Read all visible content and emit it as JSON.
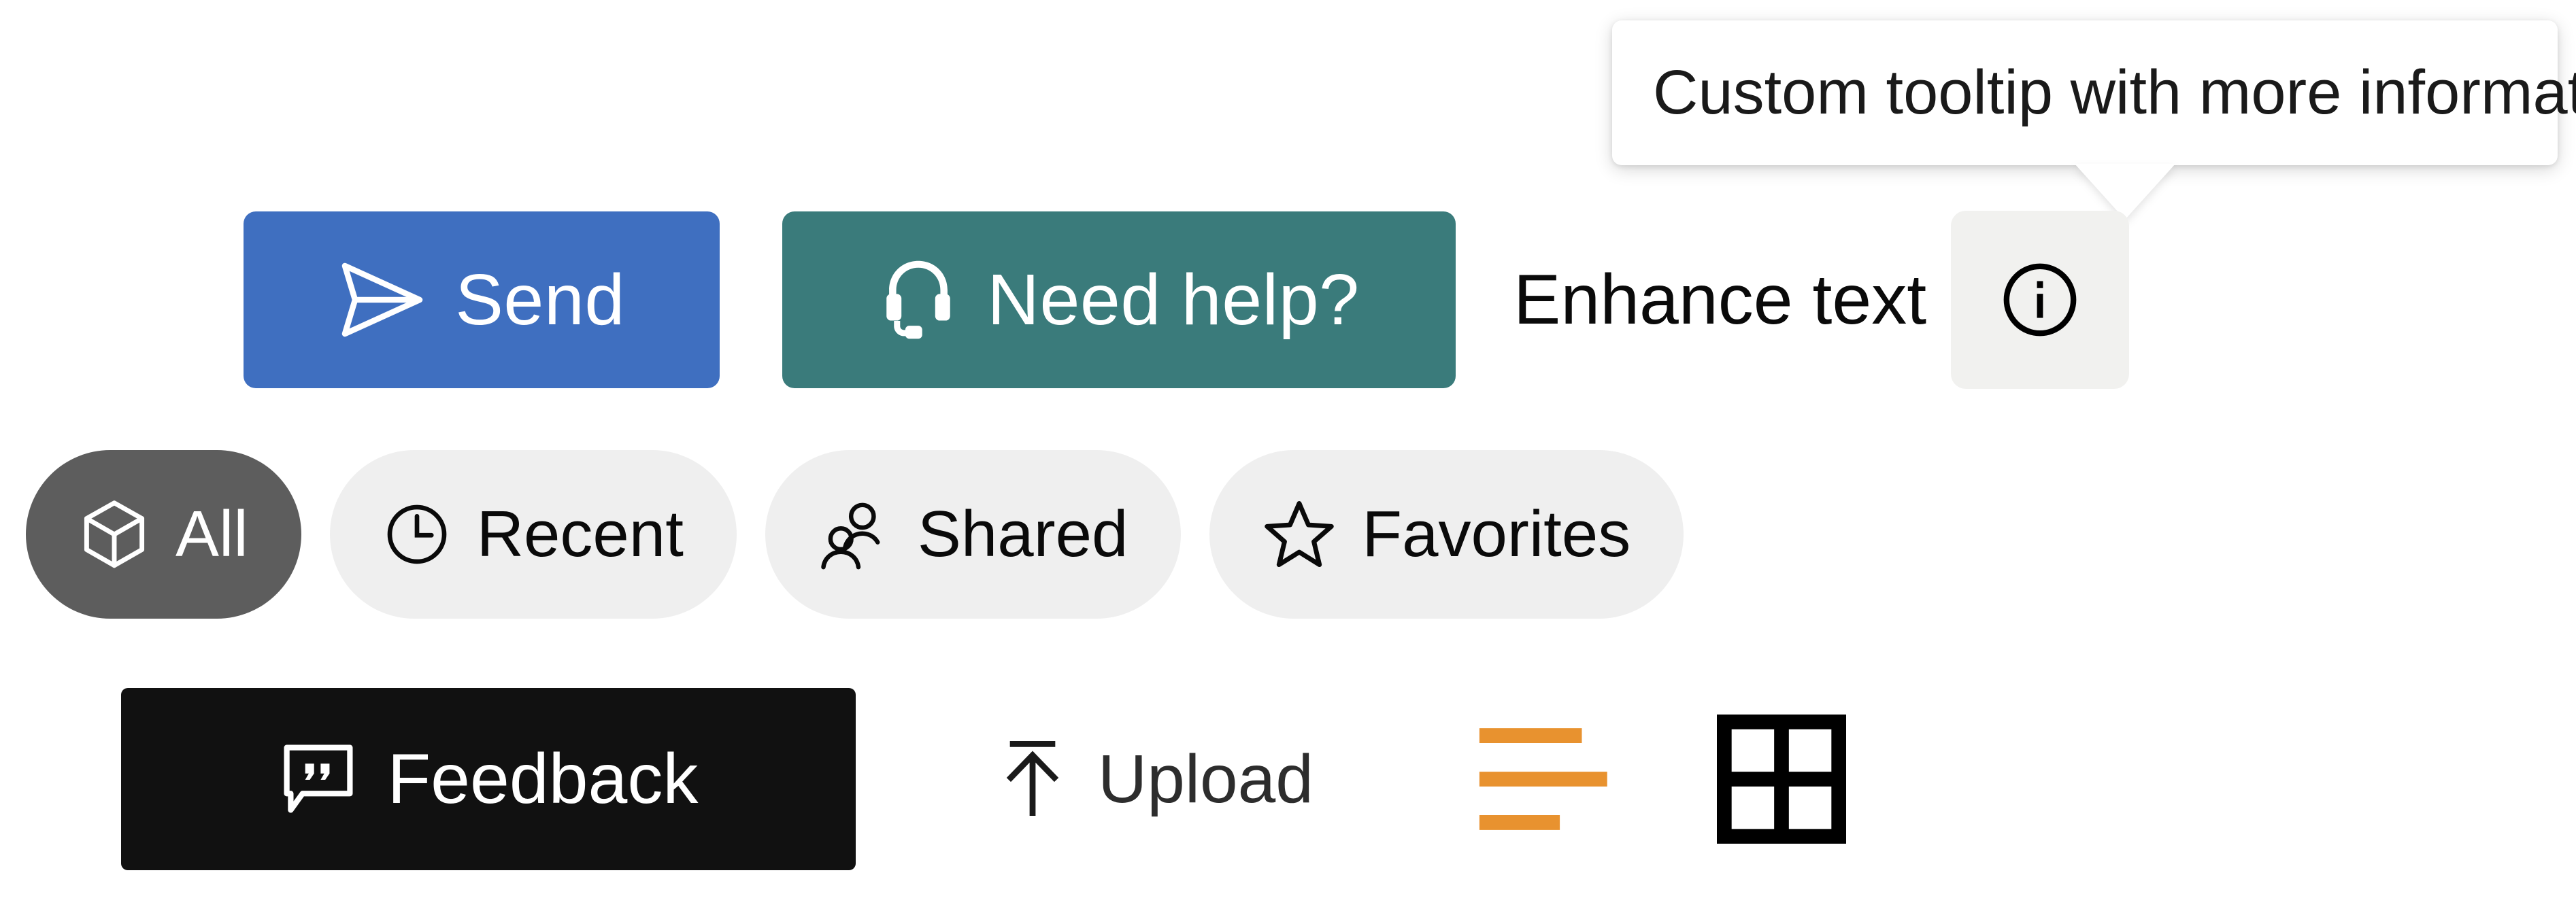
{
  "tooltip": {
    "text": "Custom tooltip with more information",
    "arrow": "tooltip-arrow-down"
  },
  "actions": {
    "send": {
      "label": "Send",
      "icon": "send-icon",
      "bg": "#3F6FC0",
      "fg": "#FFFFFF"
    },
    "help": {
      "label": "Need help?",
      "icon": "headset-icon",
      "bg": "#3A7B7B",
      "fg": "#FFFFFF"
    },
    "enhance": {
      "label": "Enhance text",
      "info_icon": "info-circle-icon",
      "info_bg": "#F1F1EF"
    }
  },
  "filters": {
    "items": [
      {
        "label": "All",
        "icon": "cube-icon",
        "selected": true,
        "bg": "#5D5D5D",
        "fg": "#FFFFFF"
      },
      {
        "label": "Recent",
        "icon": "clock-icon",
        "selected": false,
        "bg": "#EFEFEF",
        "fg": "#0A0A0A"
      },
      {
        "label": "Shared",
        "icon": "people-icon",
        "selected": false,
        "bg": "#EFEFEF",
        "fg": "#0A0A0A"
      },
      {
        "label": "Favorites",
        "icon": "star-icon",
        "selected": false,
        "bg": "#EFEFEF",
        "fg": "#0A0A0A"
      }
    ]
  },
  "bottom": {
    "feedback": {
      "label": "Feedback",
      "icon": "comment-quote-icon",
      "bg": "#111111",
      "fg": "#FFFFFF"
    },
    "upload": {
      "label": "Upload",
      "icon": "upload-arrow-icon",
      "fg": "#2D2D2D"
    },
    "view": {
      "list": {
        "icon": "list-view-icon",
        "color": "#E8922F"
      },
      "grid": {
        "icon": "grid-view-icon",
        "color": "#000000"
      }
    }
  }
}
